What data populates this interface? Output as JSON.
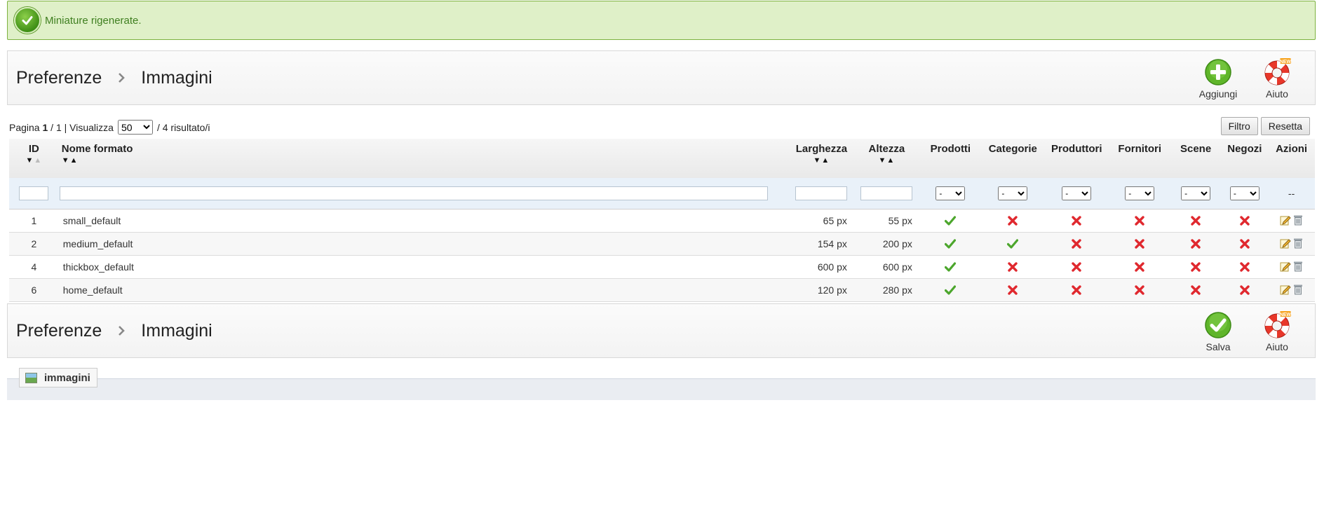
{
  "success": {
    "message": "Miniature rigenerate."
  },
  "header": {
    "crumbs": [
      "Preferenze",
      "Immagini"
    ],
    "add_label": "Aggiungi",
    "help_label": "Aiuto"
  },
  "footer_toolbar": {
    "crumbs": [
      "Preferenze",
      "Immagini"
    ],
    "save_label": "Salva",
    "help_label": "Aiuto"
  },
  "listing": {
    "page_label": "Pagina",
    "page_current": "1",
    "page_total": "/ 1",
    "show_label": "| Visualizza",
    "per_page": "50",
    "results": "/ 4 risultato/i",
    "filter_button": "Filtro",
    "reset_button": "Resetta"
  },
  "columns": {
    "id": "ID",
    "name": "Nome formato",
    "width": "Larghezza",
    "height": "Altezza",
    "products": "Prodotti",
    "categories": "Categorie",
    "manufacturers": "Produttori",
    "suppliers": "Fornitori",
    "scenes": "Scene",
    "stores": "Negozi",
    "actions": "Azioni"
  },
  "filters": {
    "select_default": "-",
    "actions_placeholder": "--"
  },
  "rows": [
    {
      "id": "1",
      "name": "small_default",
      "width": "65 px",
      "height": "55 px",
      "products": true,
      "categories": false,
      "manufacturers": false,
      "suppliers": false,
      "scenes": false,
      "stores": false
    },
    {
      "id": "2",
      "name": "medium_default",
      "width": "154 px",
      "height": "200 px",
      "products": true,
      "categories": true,
      "manufacturers": false,
      "suppliers": false,
      "scenes": false,
      "stores": false
    },
    {
      "id": "4",
      "name": "thickbox_default",
      "width": "600 px",
      "height": "600 px",
      "products": true,
      "categories": false,
      "manufacturers": false,
      "suppliers": false,
      "scenes": false,
      "stores": false
    },
    {
      "id": "6",
      "name": "home_default",
      "width": "120 px",
      "height": "280 px",
      "products": true,
      "categories": false,
      "manufacturers": false,
      "suppliers": false,
      "scenes": false,
      "stores": false
    }
  ],
  "fieldset": {
    "legend": "immagini"
  },
  "colors": {
    "yes": "#4ca62c",
    "no": "#e0282e",
    "success_bg": "#dff0c8"
  }
}
